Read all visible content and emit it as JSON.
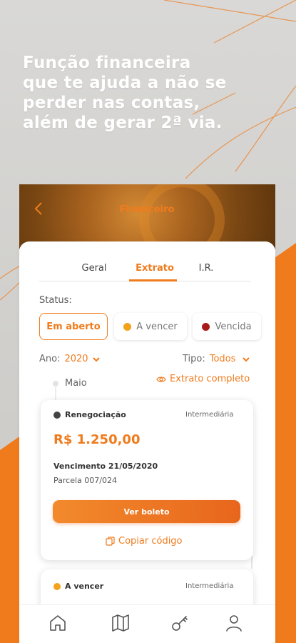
{
  "headline": {
    "lines": [
      "Função financeira",
      "que te ajuda a não se",
      "perder nas contas,",
      "além de gerar 2ª via."
    ]
  },
  "header": {
    "title": "Financeiro",
    "back_icon": "chevron-left-icon"
  },
  "tabs": [
    {
      "label": "Geral",
      "active": false
    },
    {
      "label": "Extrato",
      "active": true
    },
    {
      "label": "I.R.",
      "active": false
    }
  ],
  "status": {
    "label": "Status:",
    "chips": [
      {
        "label": "Em aberto",
        "active": true
      },
      {
        "label": "A vencer",
        "dot_color": "#f2a31b"
      },
      {
        "label": "Vencida",
        "dot_color": "#a81b1b"
      }
    ]
  },
  "filters": {
    "year_label": "Ano:",
    "year_value": "2020",
    "type_label": "Tipo:",
    "type_value": "Todos"
  },
  "timeline": {
    "month": "Maio",
    "extrato_link": "Extrato completo"
  },
  "bills": [
    {
      "type": "Renegociação",
      "dot_color": "#444444",
      "tag": "Intermediária",
      "amount": "R$ 1.250,00",
      "due": "Vencimento 21/05/2020",
      "parcel": "Parcela 007/024",
      "button": "Ver boleto",
      "copy": "Copiar código"
    },
    {
      "type": "A vencer",
      "dot_color": "#f2a31b",
      "tag": "Intermediária"
    }
  ],
  "nav": [
    "home-icon",
    "map-icon",
    "key-icon",
    "user-icon"
  ],
  "colors": {
    "accent": "#f07b1c",
    "background": "#d6d5d3"
  }
}
